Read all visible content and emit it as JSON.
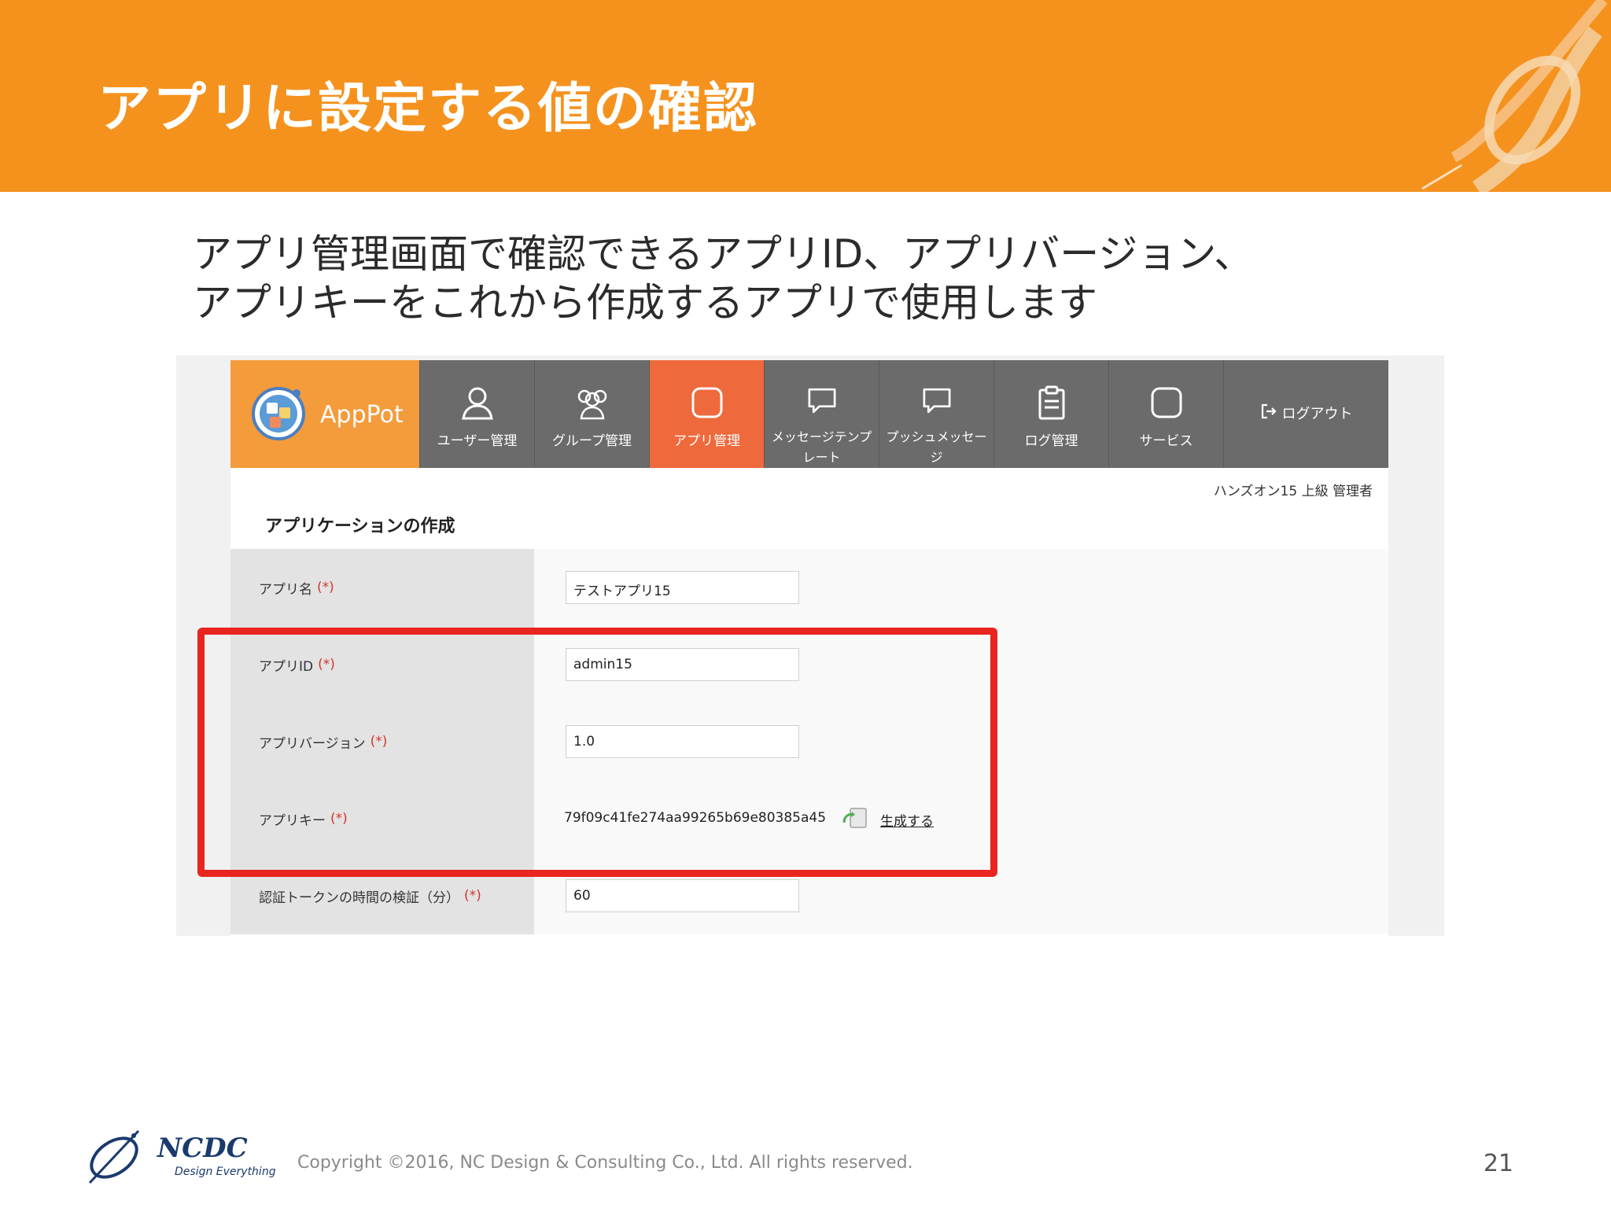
{
  "slide": {
    "title": "アプリに設定する値の確認",
    "subtitle_line1": "アプリ管理画面で確認できるアプリID、アプリバージョン、",
    "subtitle_line2": "アプリキーをこれから作成するアプリで使用します",
    "copyright": "Copyright ©2016, NC Design & Consulting Co., Ltd. All rights reserved.",
    "page_number": "21",
    "logo_word": "NCDC",
    "logo_tagline": "Design Everything",
    "accent_color": "#F5921E",
    "highlight_color": "#E8251F"
  },
  "app": {
    "brand": "AppPot",
    "nav": [
      {
        "label": "ユーザー管理",
        "icon": "user-icon"
      },
      {
        "label": "グループ管理",
        "icon": "group-icon"
      },
      {
        "label": "アプリ管理",
        "icon": "app-icon",
        "active": true
      },
      {
        "label_line1": "メッセージテンプ",
        "label_line2": "レート",
        "icon": "message-template-icon"
      },
      {
        "label_line1": "プッシュメッセー",
        "label_line2": "ジ",
        "icon": "push-message-icon"
      },
      {
        "label": "ログ管理",
        "icon": "clipboard-icon"
      },
      {
        "label": "サービス",
        "icon": "service-icon"
      }
    ],
    "logout": "ログアウト",
    "user_info": "ハンズオン15 上級 管理者",
    "page_heading": "アプリケーションの作成",
    "required_mark": "(*)",
    "fields": {
      "app_name": {
        "label": "アプリ名",
        "value": "テストアプリ15"
      },
      "app_id": {
        "label": "アプリID",
        "value": "admin15"
      },
      "app_version": {
        "label": "アプリバージョン",
        "value": "1.0"
      },
      "app_key": {
        "label": "アプリキー",
        "value": "79f09c41fe274aa99265b69e80385a45",
        "generate_label": "生成する"
      },
      "token_validity": {
        "label": "認証トークンの時間の検証（分）",
        "value": "60"
      }
    }
  }
}
